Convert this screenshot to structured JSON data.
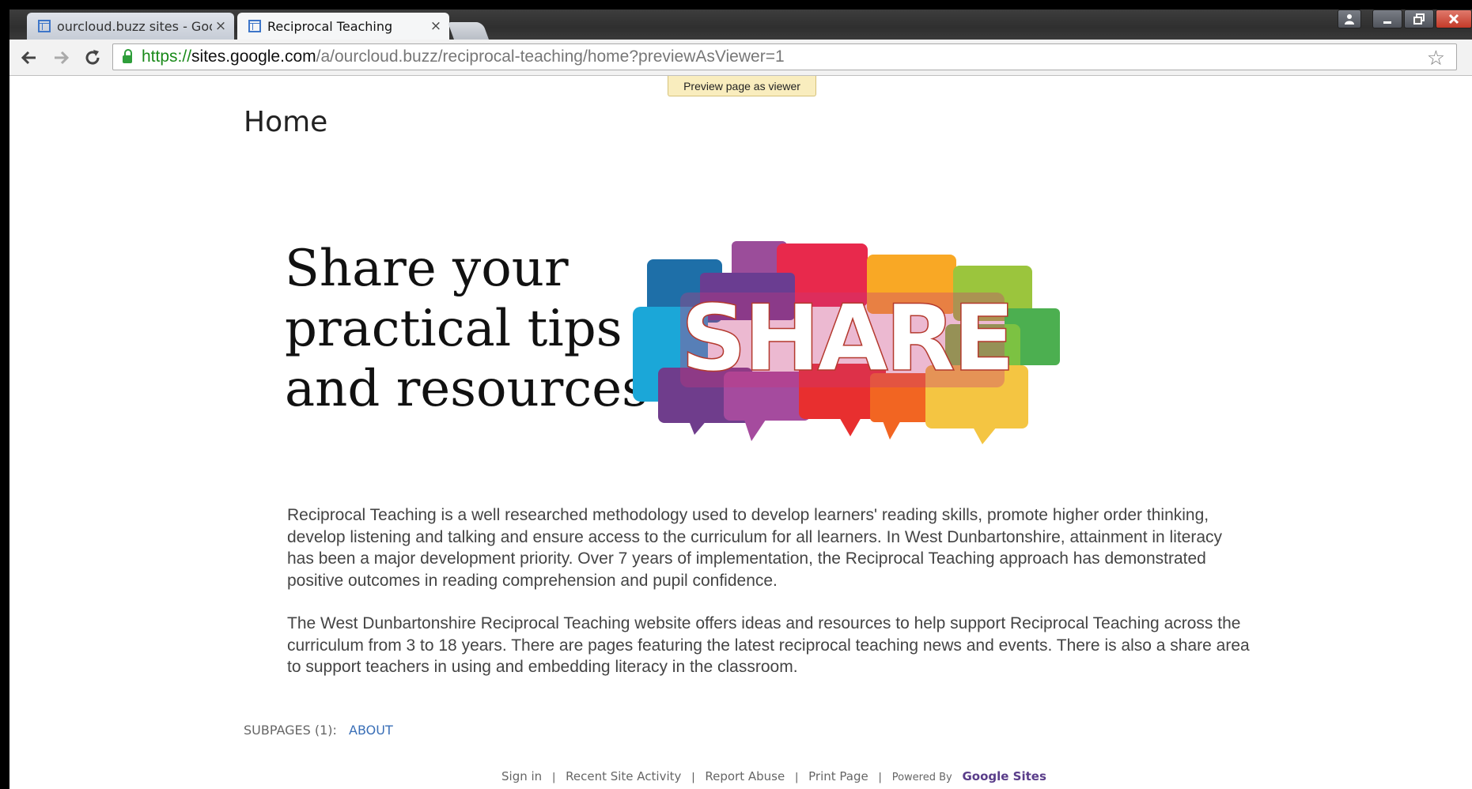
{
  "browser": {
    "tabs": [
      {
        "title": "ourcloud.buzz sites - Goo",
        "close": "×"
      },
      {
        "title": "Reciprocal Teaching",
        "close": "×"
      }
    ],
    "url": {
      "scheme": "https://",
      "host": "sites.google.com",
      "path": "/a/ourcloud.buzz/reciprocal-teaching/home?previewAsViewer=1"
    },
    "preview_badge": "Preview page as viewer"
  },
  "page": {
    "title": "Home",
    "hero_lines": [
      "Share your",
      "practical tips",
      "and resources"
    ],
    "share_word": "SHARE",
    "paragraphs": [
      "Reciprocal Teaching is a well researched methodology used to develop learners' reading skills, promote higher order thinking, develop listening and talking and ensure access to the curriculum for all learners. In West Dunbartonshire, attainment in literacy has been a major development priority. Over 7 years of implementation, the Reciprocal Teaching approach has demonstrated positive outcomes in reading comprehension and pupil confidence.",
      "The West Dunbartonshire Reciprocal Teaching website offers ideas and resources to help support Reciprocal Teaching across the curriculum from 3 to 18 years. There are pages featuring the latest reciprocal teaching news and events. There is also a  share area to support teachers in using and embedding literacy in the classroom."
    ],
    "subpages_label": "SUBPAGES (1):",
    "subpages_link": "ABOUT"
  },
  "footer": {
    "sign_in": "Sign in",
    "recent_activity": "Recent Site Activity",
    "report_abuse": "Report Abuse",
    "print_page": "Print Page",
    "powered_by": "Powered By",
    "google_sites": "Google Sites",
    "separator": "|"
  },
  "icons": {
    "back": "back-arrow-icon",
    "forward": "forward-arrow-icon",
    "reload": "reload-icon",
    "lock": "lock-icon",
    "star": "star-icon",
    "menu": "menu-icon"
  },
  "colors": {
    "url_scheme": "#1a8a1a",
    "link": "#3a6fb7",
    "preview_badge_bg": "#f9edbe",
    "google_sites": "#5a3d8a"
  }
}
